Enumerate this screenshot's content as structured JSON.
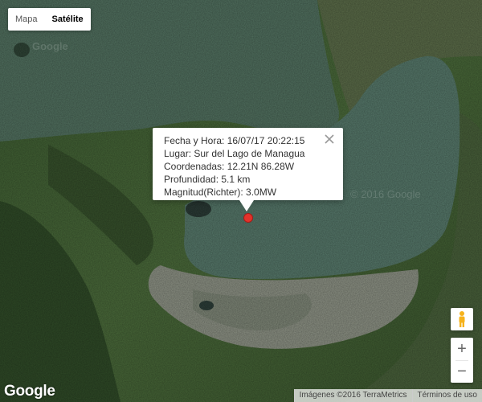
{
  "map_type_control": {
    "map_label": "Mapa",
    "satellite_label": "Satélite",
    "selected": "Satélite"
  },
  "info_window": {
    "lines": [
      "Fecha y Hora: 16/07/17 20:22:15",
      "Lugar: Sur del Lago de Managua",
      "Coordenadas: 12.21N 86.28W",
      "Profundidad: 5.1 km",
      "Magnitud(Richter): 3.0MW"
    ]
  },
  "marker": {
    "color": "#e3322b"
  },
  "controls": {
    "pegman_icon": "pegman-icon",
    "zoom_in_label": "+",
    "zoom_out_label": "−"
  },
  "branding": {
    "logo": "Google",
    "watermark": "Google",
    "watermark2": "© 2016 Google"
  },
  "footer": {
    "imagery": "Imágenes ©2016 TerraMetrics",
    "terms": "Términos de uso"
  },
  "colors": {
    "water": "#4f6e63",
    "land_forest": "#3f5d34",
    "urban": "#9a9f95"
  }
}
